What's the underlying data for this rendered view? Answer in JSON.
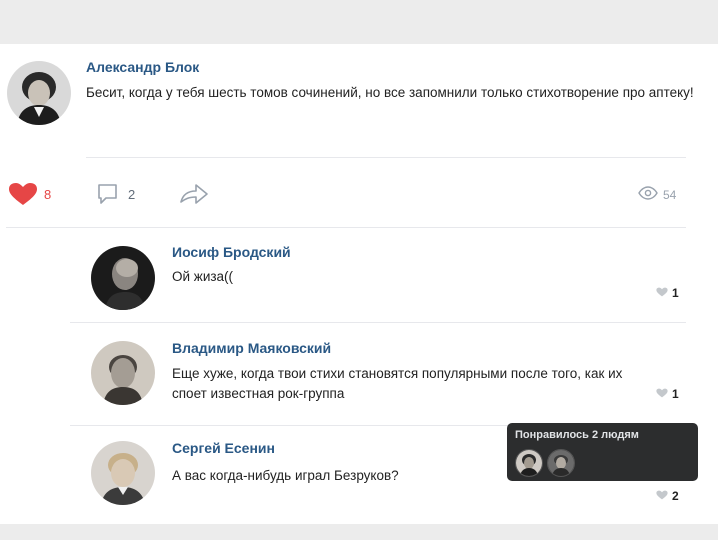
{
  "post": {
    "author": "Александр Блок",
    "text": "Бесит, когда у тебя шесть томов сочинений, но все запомнили только стихотворение про аптеку!",
    "likes": "8",
    "comments": "2",
    "views": "54"
  },
  "icons": {
    "like": "heart-icon",
    "comment": "comment-icon",
    "share": "share-icon",
    "views": "eye-icon",
    "comment_like": "heart-icon"
  },
  "colors": {
    "author_link": "#2a5885",
    "like_active": "#e64646",
    "muted": "#99a2ad",
    "tooltip_bg": "#2c2d2e"
  },
  "comments": [
    {
      "author": "Иосиф Бродский",
      "text": "Ой жиза((",
      "likes": "1"
    },
    {
      "author": "Владимир Маяковский",
      "text": "Еще хуже, когда твои стихи становятся популярными после того, как их споет известная рок-группа",
      "likes": "1"
    },
    {
      "author": "Сергей Есенин",
      "text": "А вас когда-нибудь играл Безруков?",
      "likes": "2"
    }
  ],
  "tooltip": {
    "title": "Понравилось 2 людям"
  }
}
